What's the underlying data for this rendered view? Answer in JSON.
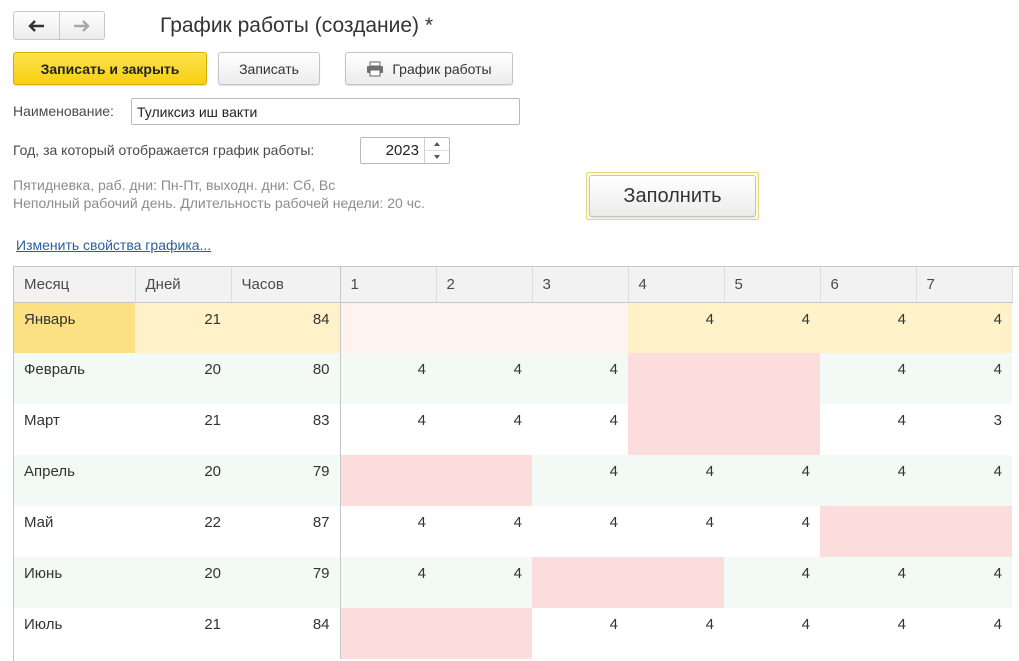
{
  "title": "График работы (создание) *",
  "toolbar": {
    "save_close": "Записать и закрыть",
    "save": "Записать",
    "schedule": "График работы"
  },
  "form": {
    "name_label": "Наименование:",
    "name_value": "Туликсиз иш вакти",
    "year_label": "Год, за который отображается график работы:",
    "year_value": "2023",
    "hint_line1": "Пятидневка, раб. дни: Пн-Пт, выходн. дни: Сб, Вс",
    "hint_line2": "Неполный рабочий день. Длительность рабочей недели: 20 чс.",
    "fill_button": "Заполнить",
    "change_link": "Изменить свойства графика..."
  },
  "table": {
    "headers": [
      "Месяц",
      "Дней",
      "Часов",
      "1",
      "2",
      "3",
      "4",
      "5",
      "6",
      "7"
    ],
    "rows": [
      {
        "month": "Январь",
        "days": "21",
        "hours": "84",
        "d": [
          "",
          "",
          "",
          "4",
          "4",
          "4",
          "4"
        ],
        "holiday": []
      },
      {
        "month": "Февраль",
        "days": "20",
        "hours": "80",
        "d": [
          "4",
          "4",
          "4",
          "",
          "",
          "4",
          "4"
        ],
        "holiday": [
          3,
          4
        ]
      },
      {
        "month": "Март",
        "days": "21",
        "hours": "83",
        "d": [
          "4",
          "4",
          "4",
          "",
          "",
          "4",
          "3"
        ],
        "holiday": [
          3,
          4
        ]
      },
      {
        "month": "Апрель",
        "days": "20",
        "hours": "79",
        "d": [
          "",
          "",
          "4",
          "4",
          "4",
          "4",
          "4"
        ],
        "holiday": [
          0,
          1
        ]
      },
      {
        "month": "Май",
        "days": "22",
        "hours": "87",
        "d": [
          "4",
          "4",
          "4",
          "4",
          "4",
          "",
          ""
        ],
        "holiday": [
          5,
          6
        ]
      },
      {
        "month": "Июнь",
        "days": "20",
        "hours": "79",
        "d": [
          "4",
          "4",
          "",
          "",
          "4",
          "4",
          "4"
        ],
        "holiday": [
          2,
          3
        ]
      },
      {
        "month": "Июль",
        "days": "21",
        "hours": "84",
        "d": [
          "",
          "",
          "4",
          "4",
          "4",
          "4",
          "4"
        ],
        "holiday": [
          0,
          1
        ]
      }
    ]
  },
  "colors": {
    "holiday": "#fddcdc",
    "selected_row": "#fff2c9",
    "primary_button": "#f9d52b"
  }
}
